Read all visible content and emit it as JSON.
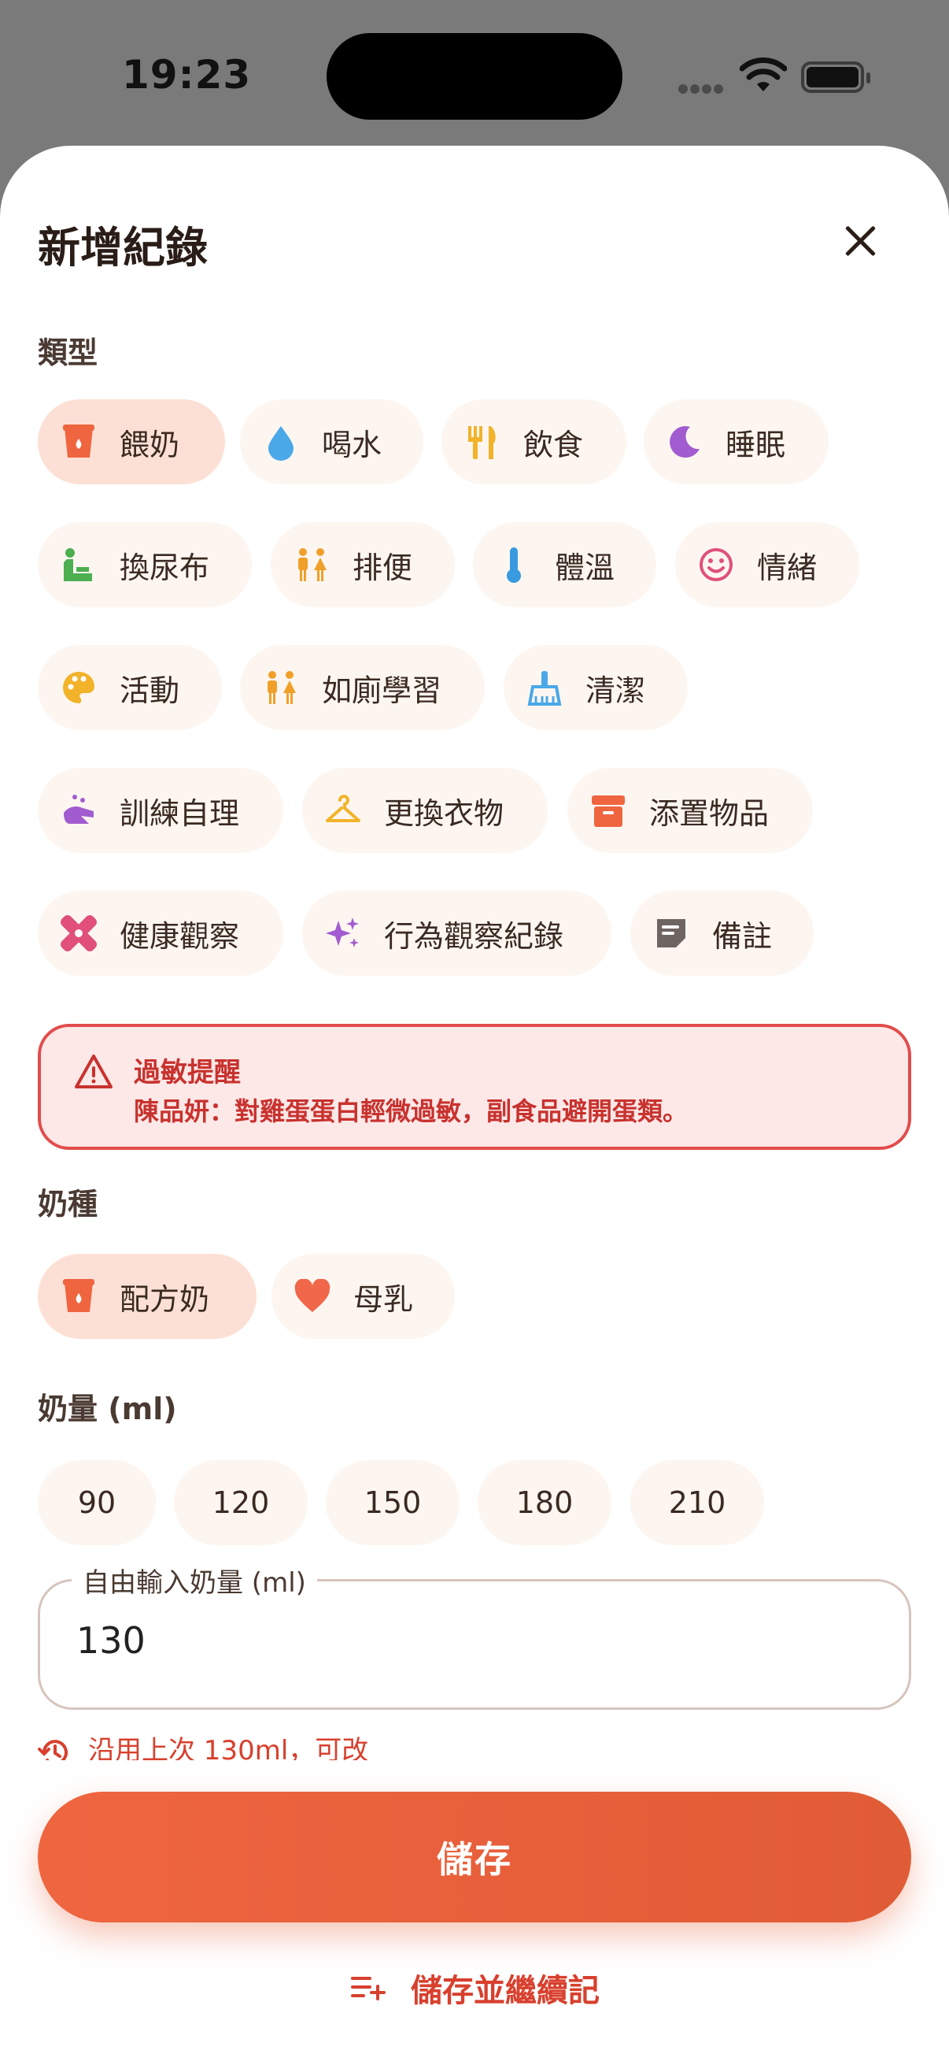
{
  "status": {
    "time": "19:23"
  },
  "sheet": {
    "title": "新增紀錄"
  },
  "type_section": {
    "label": "類型",
    "items": [
      {
        "label": "餵奶",
        "icon": "bottle-icon",
        "selected": true
      },
      {
        "label": "喝水",
        "icon": "water-drop-icon"
      },
      {
        "label": "飲食",
        "icon": "utensils-icon"
      },
      {
        "label": "睡眠",
        "icon": "moon-icon"
      },
      {
        "label": "換尿布",
        "icon": "diaper-change-icon"
      },
      {
        "label": "排便",
        "icon": "restroom-icon"
      },
      {
        "label": "體溫",
        "icon": "thermometer-icon"
      },
      {
        "label": "情緒",
        "icon": "smiley-icon"
      },
      {
        "label": "活動",
        "icon": "palette-icon"
      },
      {
        "label": "如廁學習",
        "icon": "restroom-icon"
      },
      {
        "label": "清潔",
        "icon": "broom-icon"
      },
      {
        "label": "訓練自理",
        "icon": "washing-hands-icon"
      },
      {
        "label": "更換衣物",
        "icon": "hanger-icon"
      },
      {
        "label": "添置物品",
        "icon": "archive-box-icon"
      },
      {
        "label": "健康觀察",
        "icon": "bandage-icon"
      },
      {
        "label": "行為觀察紀錄",
        "icon": "sparkles-icon"
      },
      {
        "label": "備註",
        "icon": "note-icon"
      }
    ]
  },
  "allergy": {
    "title": "過敏提醒",
    "text": "陳品妍：對雞蛋蛋白輕微過敏，副食品避開蛋類。"
  },
  "milk_type": {
    "label": "奶種",
    "items": [
      {
        "label": "配方奶",
        "icon": "bottle-icon",
        "selected": true
      },
      {
        "label": "母乳",
        "icon": "heart-icon"
      }
    ]
  },
  "amount": {
    "label": "奶量 (ml)",
    "presets": [
      "90",
      "120",
      "150",
      "180",
      "210"
    ],
    "field_label": "自由輸入奶量 (ml)",
    "field_value": "130",
    "hint": "沿用上次 130ml，可改"
  },
  "actions": {
    "save": "儲存",
    "save_continue": "儲存並繼續記"
  },
  "colors": {
    "accent": "#e8623a",
    "chip_bg": "#fdf6f0",
    "chip_selected_bg": "#fde0d5",
    "alert_border": "#e24c4c",
    "alert_bg": "#fde8e8"
  }
}
